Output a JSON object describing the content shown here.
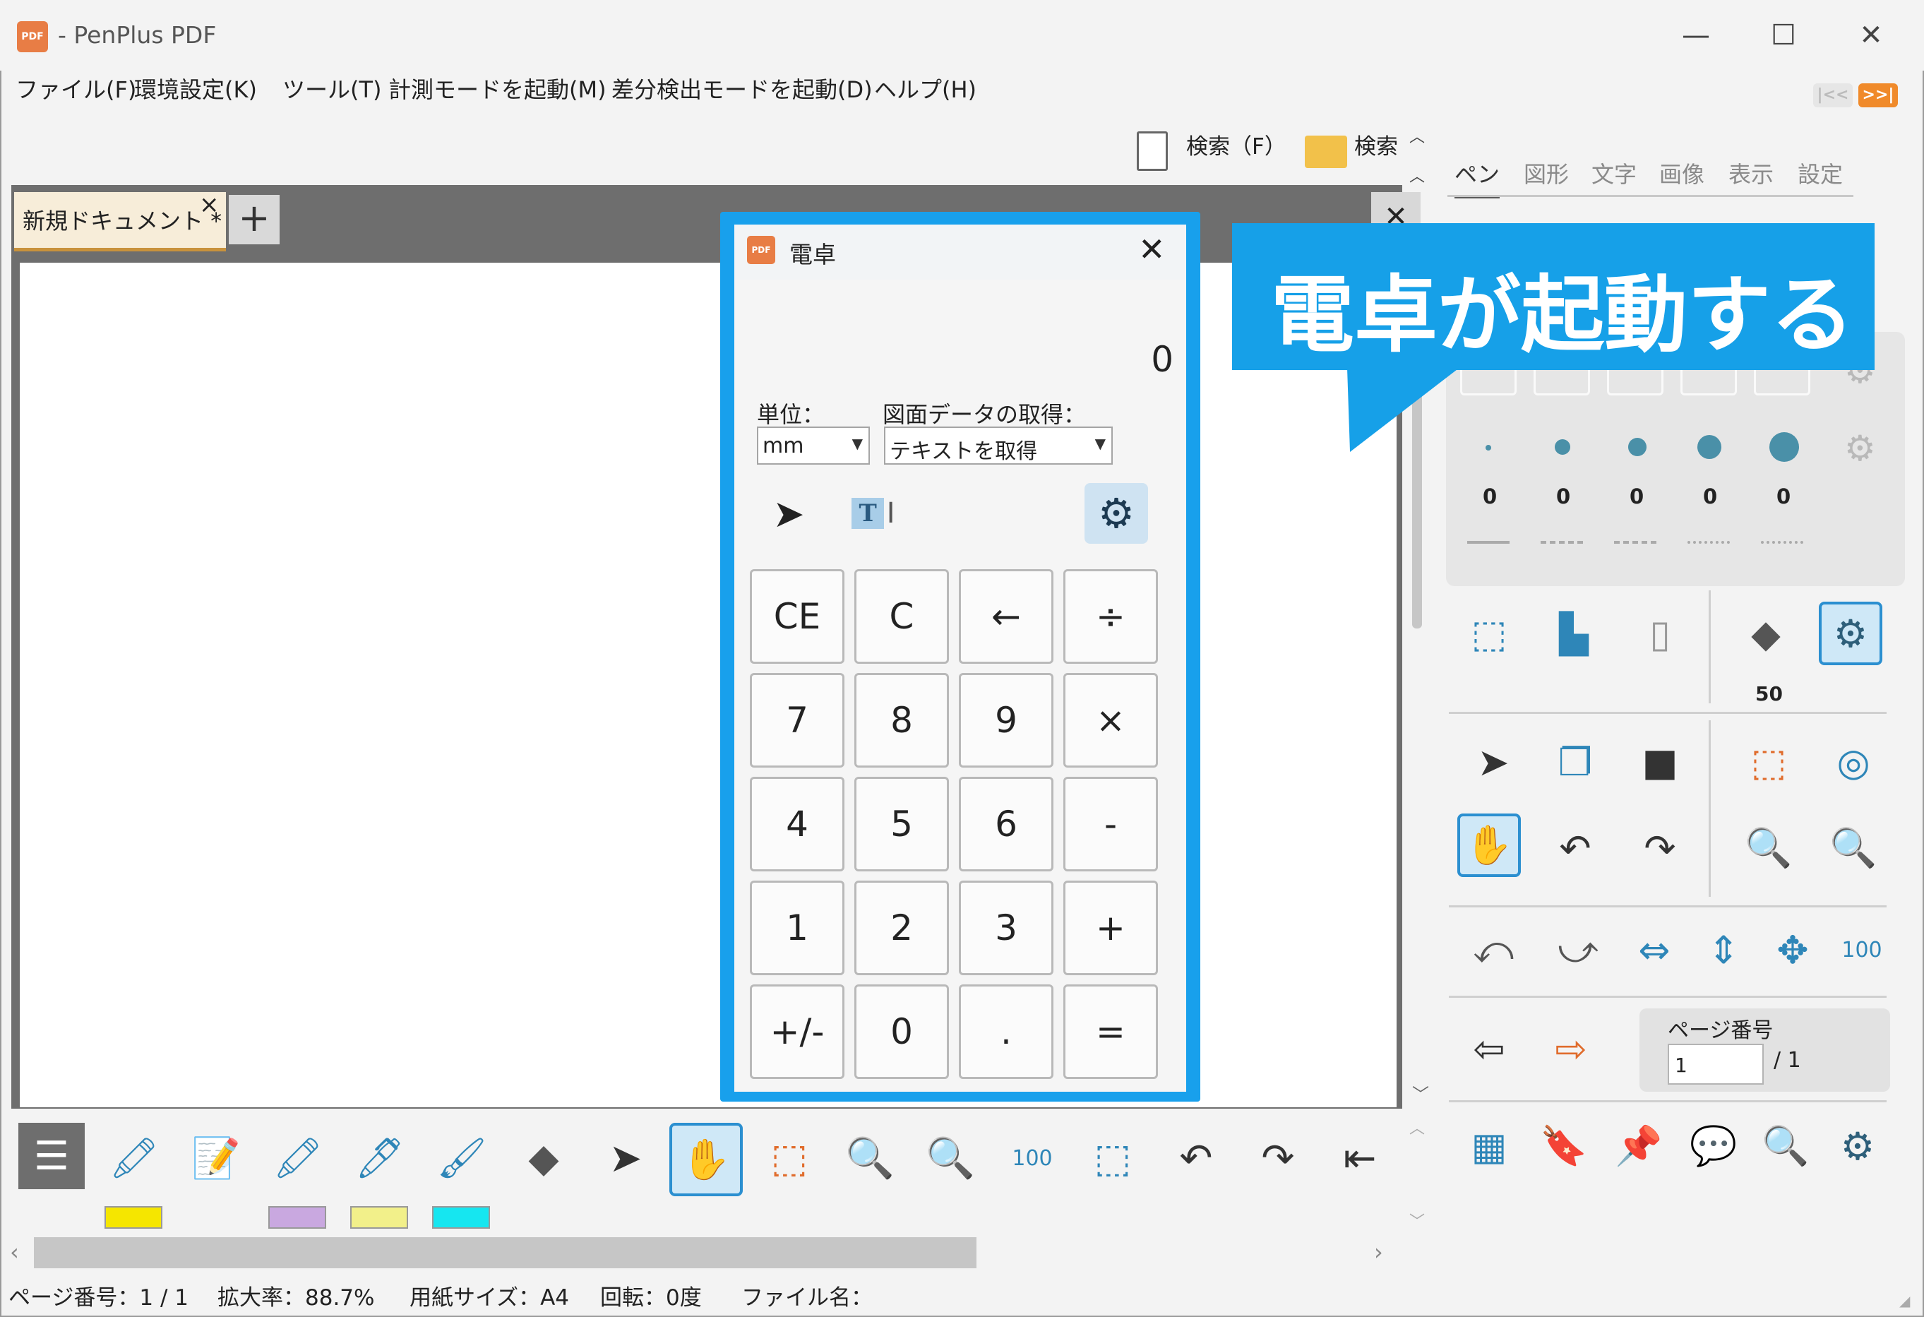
{
  "app": {
    "title": "- PenPlus PDF",
    "icon_label": "PDF",
    "window_controls": [
      "—",
      "☐",
      "✕"
    ]
  },
  "menu": {
    "items": [
      "ファイル(F)",
      "環境設定(K)",
      "ツール(T)",
      "計測モードを起動(M)",
      "差分検出モードを起動(D)",
      "ヘルプ(H)"
    ],
    "nav_prev": "|<<",
    "nav_next": ">>|"
  },
  "search": {
    "search_label": "検索（F）",
    "folder_search_label": "検索"
  },
  "document": {
    "tab_label": "新規ドキュメント *",
    "tab_close": "×",
    "add_tab": "+",
    "strip_close": "✕"
  },
  "callout": {
    "text": "電卓が起動する",
    "color": "#16a0e8"
  },
  "calculator": {
    "title": "電卓",
    "icon_label": "PDF",
    "close": "✕",
    "display": "0",
    "unit_label": "単位：",
    "unit_value": "mm",
    "data_label": "図面データの取得：",
    "data_value": "テキストを取得",
    "text_tool": "T",
    "buttons": [
      [
        "CE",
        "C",
        "←",
        "÷"
      ],
      [
        "7",
        "8",
        "9",
        "×"
      ],
      [
        "4",
        "5",
        "6",
        "-"
      ],
      [
        "1",
        "2",
        "3",
        "+"
      ],
      [
        "+/-",
        "0",
        ".",
        "="
      ]
    ]
  },
  "right_panel": {
    "tabs": [
      "ペン",
      "図形",
      "文字",
      "画像",
      "表示",
      "設定"
    ],
    "active_tab": "ペン",
    "pen_sizes": [
      "0",
      "0",
      "0",
      "0",
      "0"
    ],
    "eraser_size": "50",
    "page_label": "ページ番号",
    "page_input": "1",
    "page_total": "/ 1"
  },
  "bottom_toolbar": {
    "swatch_colors": [
      "#f5e600",
      "#c9a8e0",
      "#f2f08a",
      "#16e6f0"
    ]
  },
  "status": {
    "page": "ページ番号：1 / 1",
    "zoom": "拡大率：88.7%",
    "paper": "用紙サイズ：A4",
    "rotation": "回転：0度",
    "filename": "ファイル名："
  }
}
